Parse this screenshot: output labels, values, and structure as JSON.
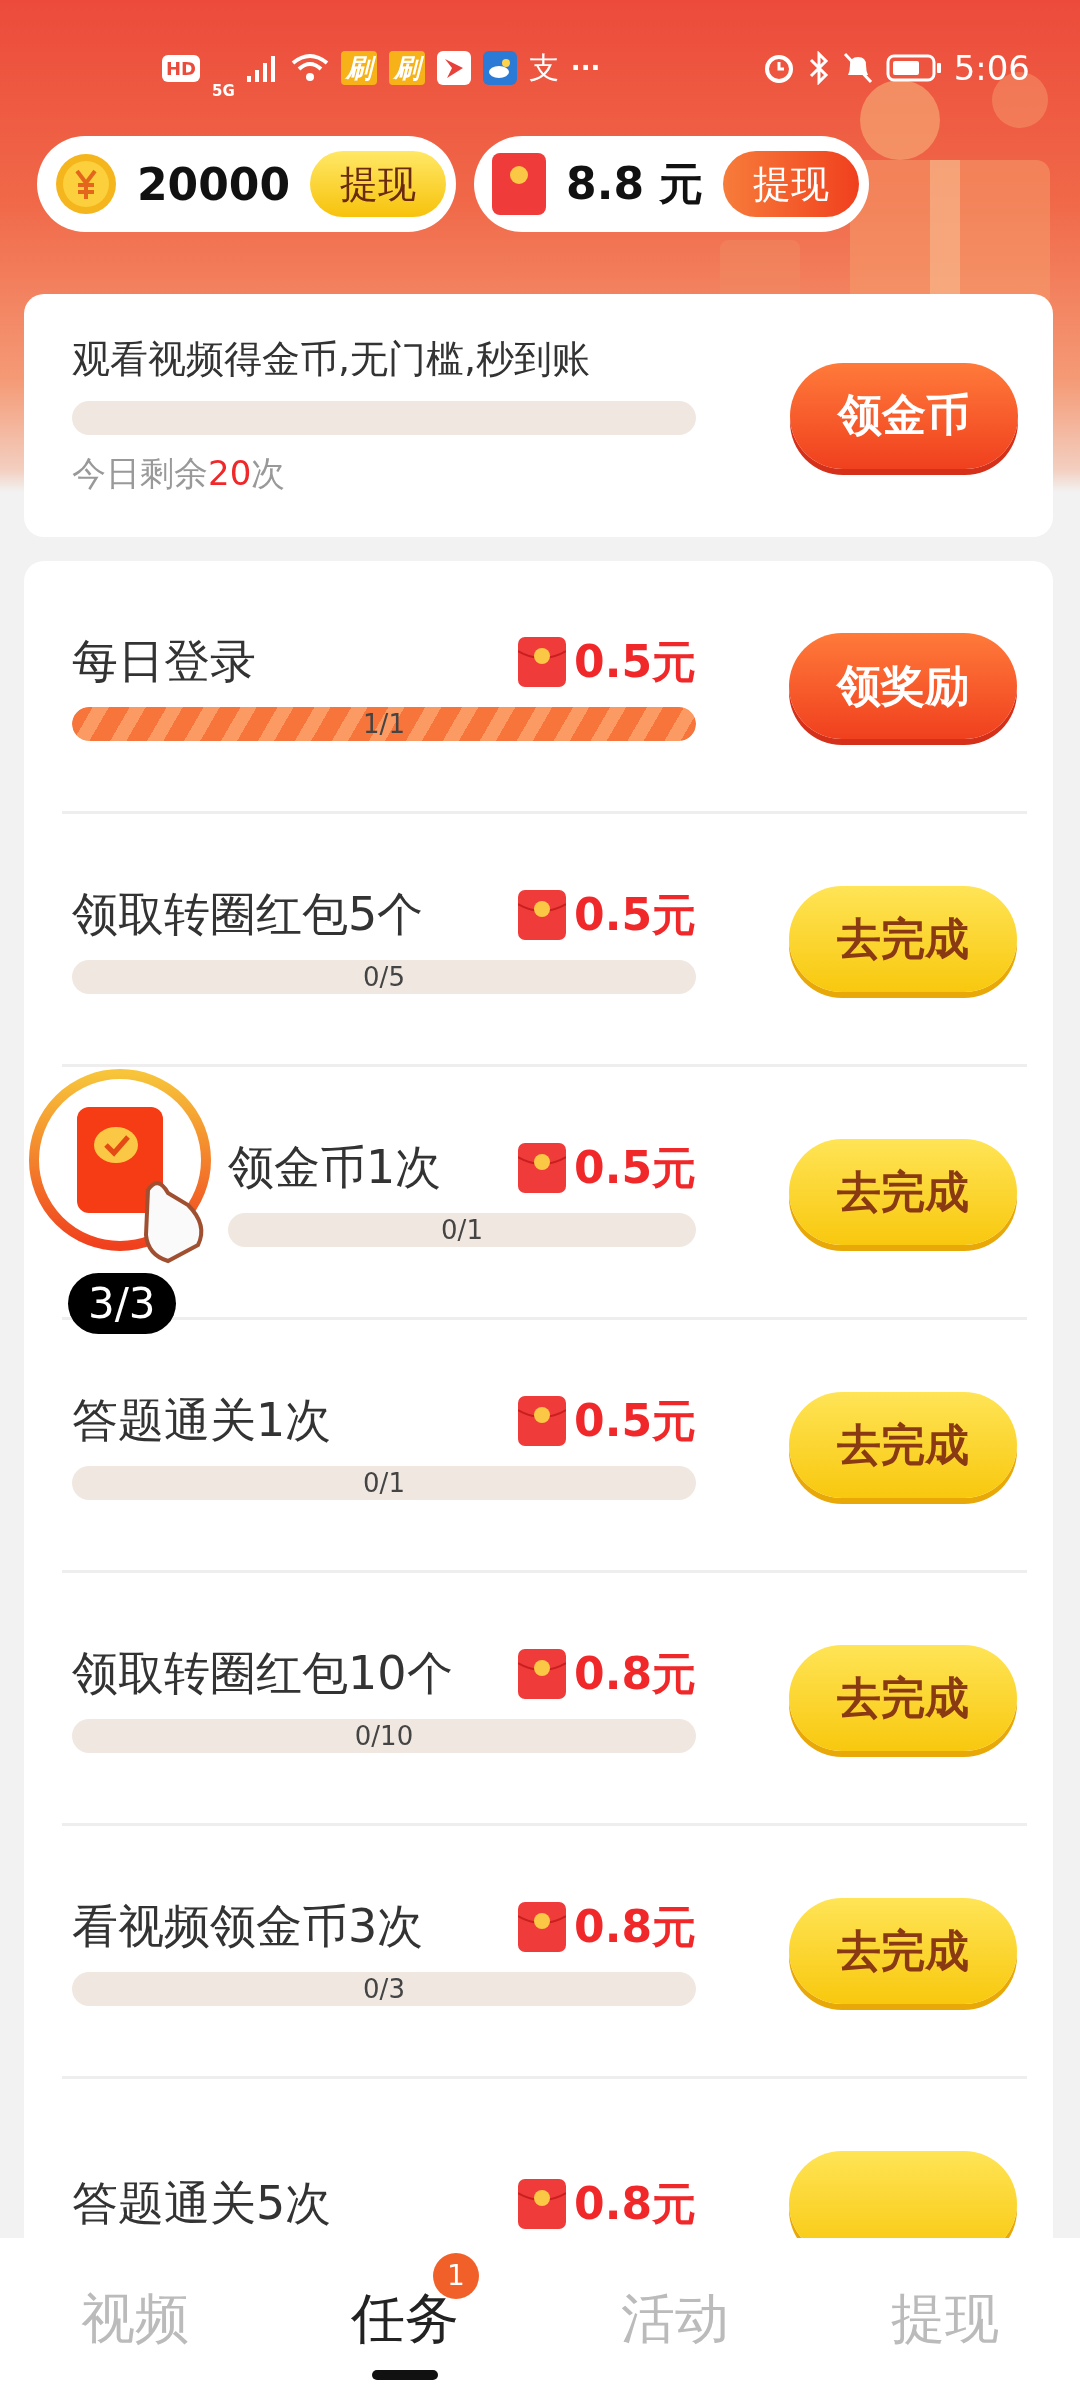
{
  "status_bar": {
    "hd": "HD",
    "network": "5G",
    "app_glyphs": [
      "刷",
      "刷"
    ],
    "pay_glyph": "支",
    "more": "···",
    "time": "5:06"
  },
  "balances": [
    {
      "kind": "coin",
      "amount": "20000",
      "button": "提现"
    },
    {
      "kind": "cash",
      "amount": "8.8 元",
      "button": "提现"
    }
  ],
  "video_card": {
    "title": "观看视频得金币,无门槛,秒到账",
    "level": 0,
    "remaining_prefix": "今日剩余",
    "remaining_count": "20",
    "remaining_suffix": "次",
    "button": "领金币"
  },
  "tasks": [
    {
      "title": "每日登录",
      "reward": "0.5元",
      "progress": "1/1",
      "level": 1,
      "button": "领奖励",
      "done": true
    },
    {
      "title": "领取转圈红包5个",
      "reward": "0.5元",
      "progress": "0/5",
      "level": 0,
      "button": "去完成",
      "done": false
    },
    {
      "title": "领金币1次",
      "reward": "0.5元",
      "progress": "0/1",
      "level": 0,
      "button": "去完成",
      "done": false,
      "floating_widget": {
        "counter": "3/3"
      }
    },
    {
      "title": "答题通关1次",
      "reward": "0.5元",
      "progress": "0/1",
      "level": 0,
      "button": "去完成",
      "done": false
    },
    {
      "title": "领取转圈红包10个",
      "reward": "0.8元",
      "progress": "0/10",
      "level": 0,
      "button": "去完成",
      "done": false
    },
    {
      "title": "看视频领金币3次",
      "reward": "0.8元",
      "progress": "0/3",
      "level": 0,
      "button": "去完成",
      "done": false
    },
    {
      "title": "答题通关5次",
      "reward": "0.8元",
      "done": false
    }
  ],
  "bottom_nav": [
    {
      "label": "视频",
      "selected": false
    },
    {
      "label": "任务",
      "selected": true,
      "badge": "1"
    },
    {
      "label": "活动",
      "selected": false
    },
    {
      "label": "提现",
      "selected": false
    }
  ]
}
